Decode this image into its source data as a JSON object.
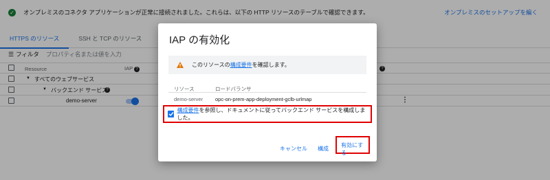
{
  "banner": {
    "message": "オンプレミスのコネクタ アプリケーションが正常に接続されました。これらは、以下の HTTP リソースのテーブルで確認できます。",
    "setup_link": "オンプレミスのセットアップを編く"
  },
  "tabs": [
    {
      "label": "HTTPS のリソース",
      "active": true
    },
    {
      "label": "SSH と TCP のリソース",
      "active": false
    }
  ],
  "filter": {
    "label": "フィルタ",
    "placeholder": "プロパティ名または値を入力"
  },
  "table": {
    "columns": {
      "resource": "Resource",
      "iap": "IAP"
    },
    "rows": [
      {
        "label": "すべてのウェブサービス"
      },
      {
        "label": "バックエンド サービス"
      },
      {
        "label": "demo-server"
      }
    ]
  },
  "dialog": {
    "title": "IAP の有効化",
    "warning": {
      "prefix": "このリソースの",
      "link": "構成要件",
      "suffix": "を確認します。"
    },
    "table": {
      "headers": [
        "リソース",
        "ロードバランサ"
      ],
      "rows": [
        [
          "demo-server",
          "opc-on-prem-app-deployment-gclb-urlmap"
        ]
      ]
    },
    "confirm": {
      "link": "構成要件",
      "text": "を参照し、ドキュメントに従ってバックエンド サービスを構成しました。",
      "checked": true
    },
    "buttons": {
      "cancel": "キャンセル",
      "configure": "構成",
      "enable": "有効にする"
    }
  },
  "colors": {
    "accent": "#1a73e8",
    "highlight": "#e00000",
    "warning": "#e37400",
    "success": "#188038"
  }
}
